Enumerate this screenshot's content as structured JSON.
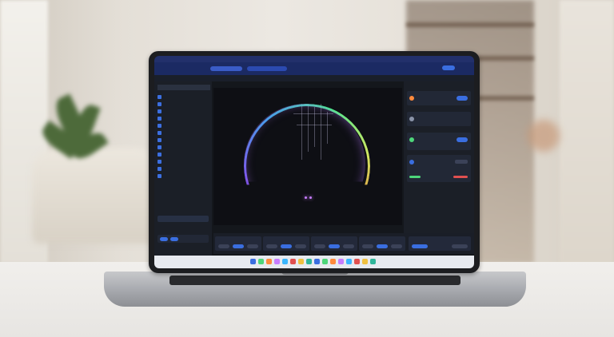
{
  "scene": "laptop-on-table",
  "colors": {
    "screen_accent": "#3a6ee0",
    "menubar": "#22306b",
    "panel": "#1b1f27",
    "ring_gradient": [
      "#ff4aa8",
      "#7b5cff",
      "#3ab6ff",
      "#4dff9c",
      "#e9ff6b",
      "#ff8a3c"
    ],
    "table": "#eeece9",
    "laptop_body": "#a9abb0"
  },
  "icons": {
    "sidebar": [
      "folder-icon",
      "image-icon",
      "star-icon",
      "clock-icon",
      "tag-icon",
      "share-icon",
      "trash-icon",
      "cloud-icon",
      "settings-icon",
      "user-icon",
      "info-icon",
      "help-icon"
    ],
    "taskbar": [
      "start-icon",
      "search-icon",
      "browser-icon",
      "files-icon",
      "mail-icon",
      "chat-icon",
      "music-icon",
      "photos-icon",
      "code-icon",
      "terminal-icon",
      "settings-icon",
      "store-icon",
      "calendar-icon",
      "notes-icon",
      "camera-icon",
      "video-icon"
    ]
  }
}
